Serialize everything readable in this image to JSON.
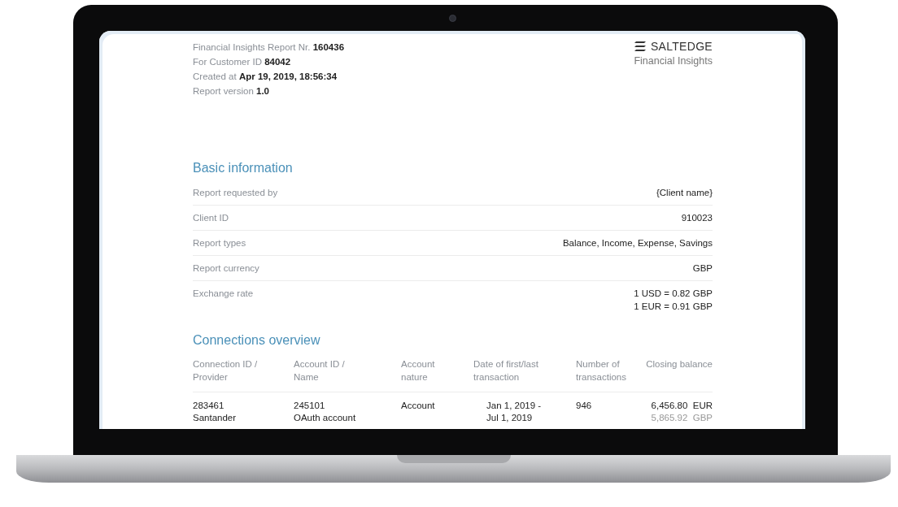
{
  "report_header": {
    "lines": [
      "Financial Insights Report Nr. **160436**",
      "For Customer ID **84042**",
      "Created at **Apr 19, 2019, 18:56:34**",
      "Report version **1.0**"
    ]
  },
  "brand": {
    "name": "SALTEDGE",
    "subtitle": "Financial Insights"
  },
  "basic_information": {
    "title": "Basic information",
    "rows": [
      {
        "label": "Report requested by",
        "values": [
          "{Client name}"
        ]
      },
      {
        "label": "Client ID",
        "values": [
          "910023"
        ]
      },
      {
        "label": "Report types",
        "values": [
          "Balance, Income, Expense, Savings"
        ]
      },
      {
        "label": "Report currency",
        "values": [
          "GBP"
        ]
      },
      {
        "label": "Exchange rate",
        "values": [
          "1 USD = 0.82 GBP",
          "1 EUR = 0.91 GBP"
        ]
      }
    ]
  },
  "connections_overview": {
    "title": "Connections overview",
    "columns": [
      {
        "lines": [
          "Connection ID /",
          "Provider"
        ]
      },
      {
        "lines": [
          "Account ID /",
          "Name"
        ]
      },
      {
        "lines": [
          "Account",
          "nature"
        ]
      },
      {
        "lines": [
          "Date of first/last",
          "transaction"
        ]
      },
      {
        "lines": [
          "Number of",
          "transactions"
        ]
      },
      {
        "lines": [
          "Closing balance"
        ]
      }
    ],
    "rows": [
      {
        "connection": [
          "283461",
          "Santander"
        ],
        "account": [
          "245101",
          "OAuth account"
        ],
        "nature": "Account",
        "dates": [
          "Jan 1, 2019 -",
          "Jul 1, 2019"
        ],
        "transactions": "946",
        "balances": [
          {
            "amount": "6,456.80",
            "currency": "EUR",
            "kind": "primary"
          },
          {
            "amount": "5,865.92",
            "currency": "GBP",
            "kind": "converted"
          }
        ]
      }
    ]
  }
}
